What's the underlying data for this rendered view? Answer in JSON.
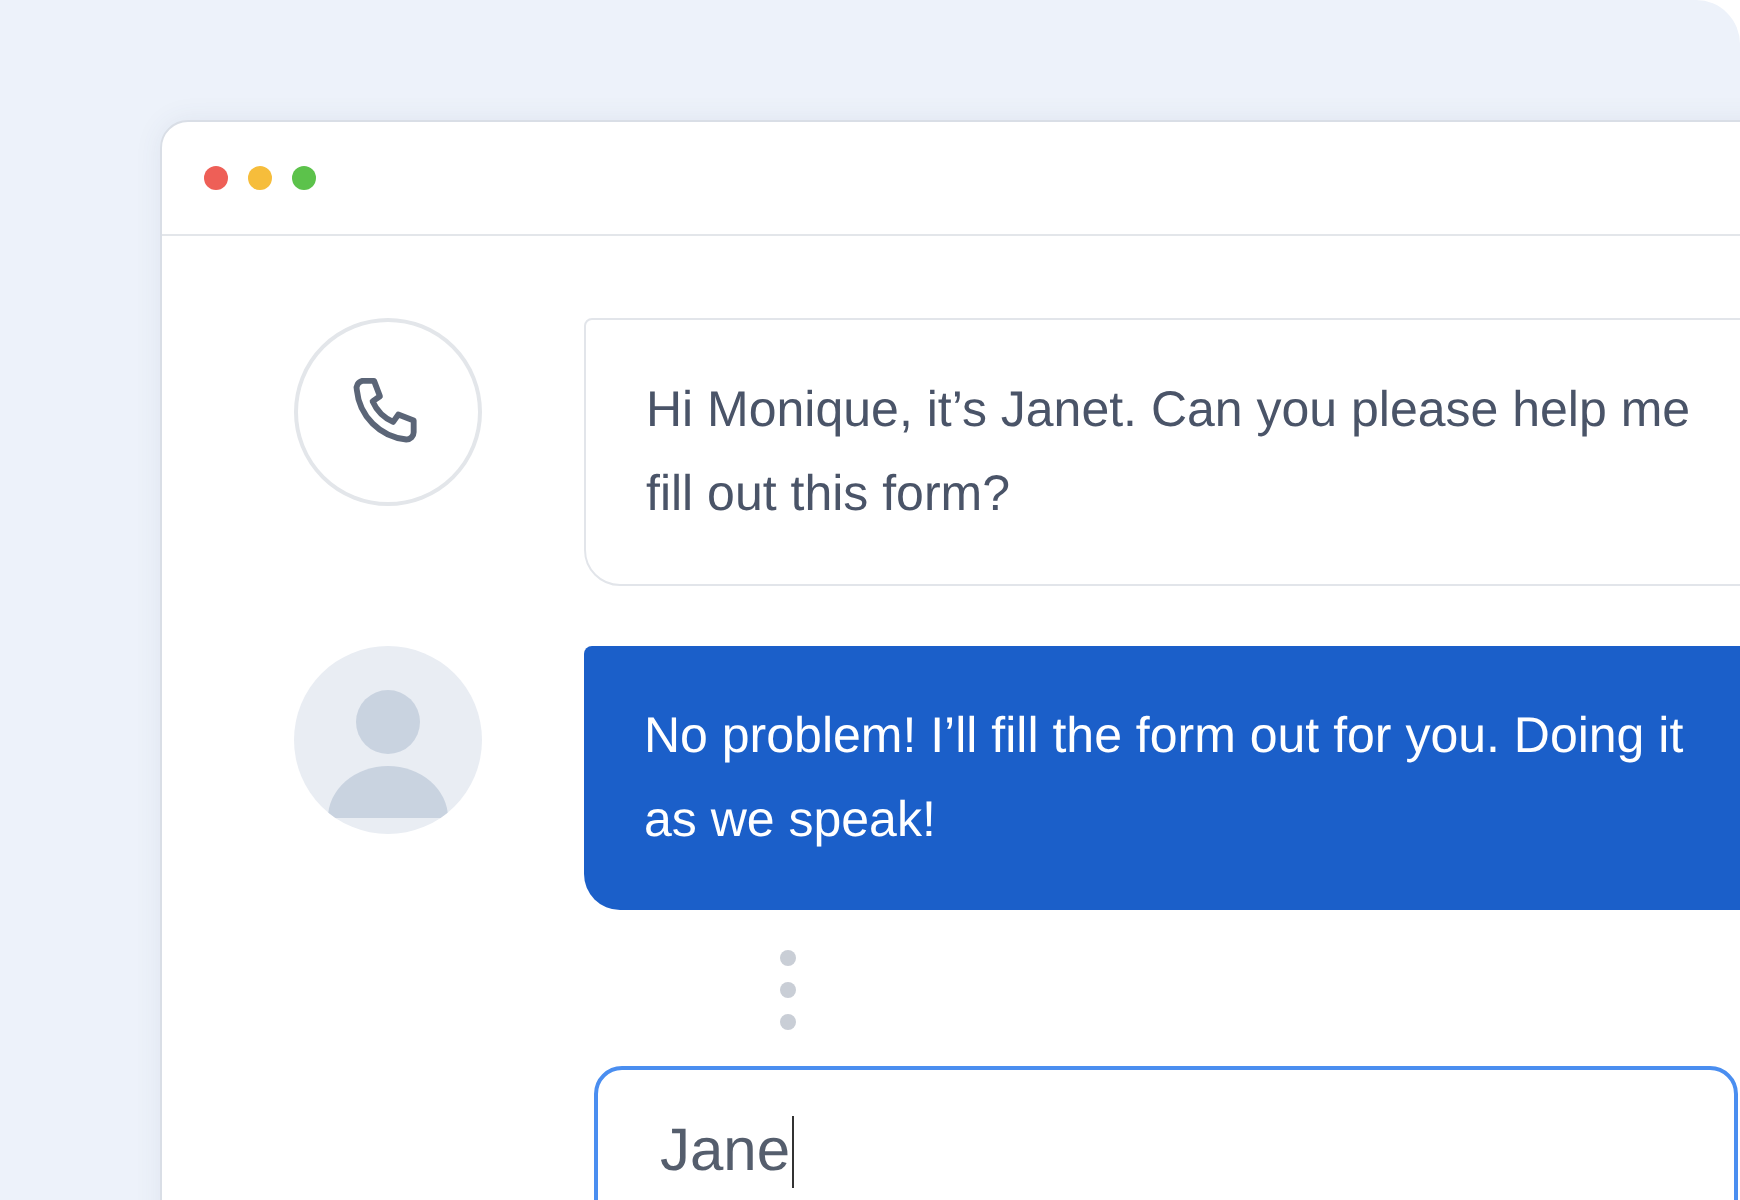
{
  "messages": [
    {
      "kind": "incoming",
      "text": "Hi Monique, it’s Janet. Can you please help me fill out this form?"
    },
    {
      "kind": "outgoing",
      "text": "No problem! I’ll fill the form out for you. Doing it as we speak!"
    }
  ],
  "input": {
    "value": "Jane"
  }
}
